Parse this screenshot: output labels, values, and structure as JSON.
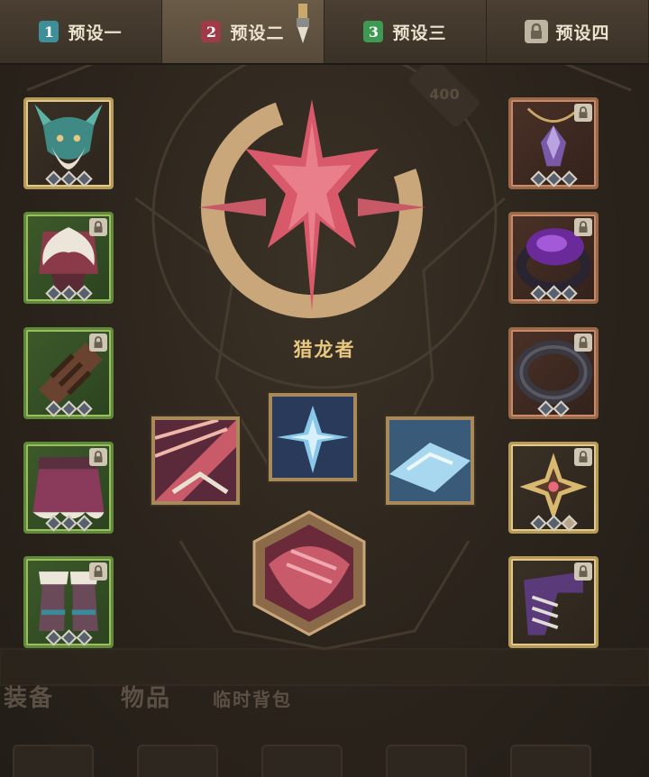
{
  "tabs": [
    {
      "number": "1",
      "label": "预设一",
      "color": "#3e8f9a",
      "active": false,
      "locked": false
    },
    {
      "number": "2",
      "label": "预设二",
      "color": "#a03a48",
      "active": true,
      "locked": false
    },
    {
      "number": "3",
      "label": "预设三",
      "color": "#3e9a52",
      "active": false,
      "locked": false
    },
    {
      "number": "",
      "label": "预设四",
      "color": "#bdb4a1",
      "active": false,
      "locked": true
    }
  ],
  "watermark_number": "400",
  "emblem": {
    "name": "猎龙者"
  },
  "left_slots": [
    {
      "item": "dragon-helmet",
      "locked": false,
      "gems": 3
    },
    {
      "item": "feathered-chest-armor",
      "locked": true,
      "gems": 3
    },
    {
      "item": "leather-bracers",
      "locked": true,
      "gems": 3
    },
    {
      "item": "feathered-skirt",
      "locked": true,
      "gems": 3
    },
    {
      "item": "fur-boots",
      "locked": true,
      "gems": 3
    }
  ],
  "right_slots": [
    {
      "item": "amethyst-amulet",
      "locked": true,
      "gems": 3
    },
    {
      "item": "purple-gem-ring",
      "locked": true,
      "gems": 3
    },
    {
      "item": "dark-bangle",
      "locked": true,
      "gems": 2
    },
    {
      "item": "ornate-relic",
      "locked": true,
      "gems": 3
    },
    {
      "item": "bladed-banner",
      "locked": true,
      "gems": 0
    }
  ],
  "bottom_nav": {
    "equipment": "装备",
    "items": "物品",
    "temp_bag": "临时背包"
  },
  "colors": {
    "accent": "#e8c780",
    "frame_gold": "#b69a5a",
    "frame_green": "#5f8a3c"
  }
}
